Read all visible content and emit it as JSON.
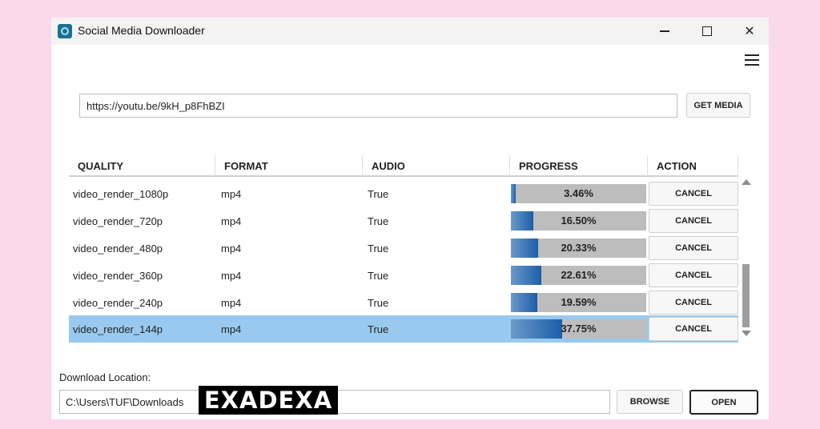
{
  "window": {
    "title": "Social Media Downloader",
    "minimize_icon": "minimize-icon",
    "maximize_icon": "maximize-icon",
    "close_icon": "close-icon"
  },
  "menu": {
    "icon": "hamburger-menu-icon"
  },
  "url_bar": {
    "value": "https://youtu.be/9kH_p8FhBZI",
    "get_media_label": "GET MEDIA"
  },
  "table": {
    "columns": [
      "QUALITY",
      "FORMAT",
      "AUDIO",
      "PROGRESS",
      "ACTION"
    ],
    "rows": [
      {
        "quality": "video_render_1080p",
        "format": "mp4",
        "audio": "True",
        "progress": "3.46%",
        "progress_value": 3.46,
        "action": "CANCEL"
      },
      {
        "quality": "video_render_720p",
        "format": "mp4",
        "audio": "True",
        "progress": "16.50%",
        "progress_value": 16.5,
        "action": "CANCEL"
      },
      {
        "quality": "video_render_480p",
        "format": "mp4",
        "audio": "True",
        "progress": "20.33%",
        "progress_value": 20.33,
        "action": "CANCEL"
      },
      {
        "quality": "video_render_360p",
        "format": "mp4",
        "audio": "True",
        "progress": "22.61%",
        "progress_value": 22.61,
        "action": "CANCEL"
      },
      {
        "quality": "video_render_240p",
        "format": "mp4",
        "audio": "True",
        "progress": "19.59%",
        "progress_value": 19.59,
        "action": "CANCEL"
      },
      {
        "quality": "video_render_144p",
        "format": "mp4",
        "audio": "True",
        "progress": "37.75%",
        "progress_value": 37.75,
        "action": "CANCEL",
        "selected": true
      }
    ]
  },
  "download": {
    "label": "Download Location:",
    "path": "C:\\Users\\TUF\\Downloads",
    "browse_label": "BROWSE",
    "open_label": "OPEN"
  },
  "watermark": {
    "text": "EXADEXA"
  },
  "colors": {
    "page_background": "#fbd8ec",
    "selected_row": "#99c9ee",
    "progress_fill": "#1b5ea8",
    "progress_track": "#bdbdbd"
  }
}
